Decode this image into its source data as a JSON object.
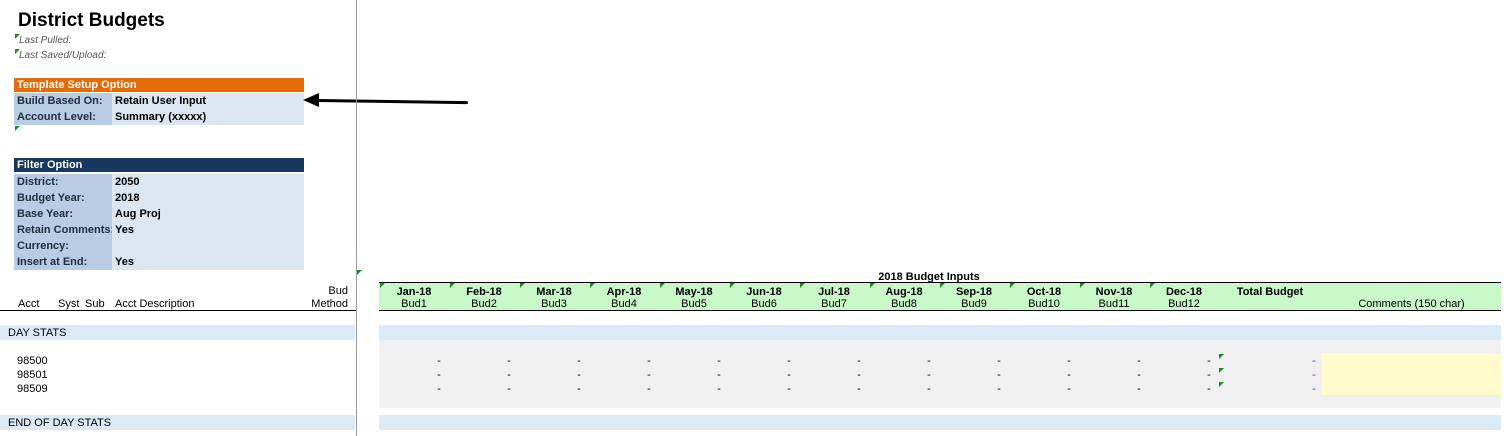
{
  "sheet": {
    "title": "District Budgets",
    "last_pulled": "Last Pulled:",
    "last_saved": "Last Saved/Upload:"
  },
  "template_setup": {
    "header": "Template Setup Option",
    "header_color": "#e36c09",
    "rows": [
      {
        "label": "Build Based On:",
        "value": "Retain User Input"
      },
      {
        "label": "Account Level:",
        "value": "Summary (xxxxx)"
      }
    ]
  },
  "filter": {
    "header": "Filter Option",
    "header_color": "#17375e",
    "rows": [
      {
        "label": "District:",
        "value": "2050"
      },
      {
        "label": "Budget Year:",
        "value": "2018"
      },
      {
        "label": "Base Year:",
        "value": "Aug Proj"
      },
      {
        "label": "Retain Comments:",
        "value": "Yes"
      },
      {
        "label": "Currency:",
        "value": ""
      },
      {
        "label": "Insert at End:",
        "value": "Yes"
      }
    ]
  },
  "columns": {
    "acct": "Acct",
    "syst": "Syst",
    "sub": "Sub",
    "acct_desc": "Acct Description",
    "bud_method_1": "Bud",
    "bud_method_2": "Method",
    "group_title": "2018 Budget Inputs",
    "months": [
      {
        "name": "Jan-18",
        "bud": "Bud1"
      },
      {
        "name": "Feb-18",
        "bud": "Bud2"
      },
      {
        "name": "Mar-18",
        "bud": "Bud3"
      },
      {
        "name": "Apr-18",
        "bud": "Bud4"
      },
      {
        "name": "May-18",
        "bud": "Bud5"
      },
      {
        "name": "Jun-18",
        "bud": "Bud6"
      },
      {
        "name": "Jul-18",
        "bud": "Bud7"
      },
      {
        "name": "Aug-18",
        "bud": "Bud8"
      },
      {
        "name": "Sep-18",
        "bud": "Bud9"
      },
      {
        "name": "Oct-18",
        "bud": "Bud10"
      },
      {
        "name": "Nov-18",
        "bud": "Bud11"
      },
      {
        "name": "Dec-18",
        "bud": "Bud12"
      }
    ],
    "total": "Total Budget",
    "comments": "Comments (150 char)"
  },
  "sections": {
    "start": "DAY STATS",
    "end": "END OF DAY STATS"
  },
  "accounts": [
    "98500",
    "98501",
    "98509"
  ],
  "dash": "-"
}
